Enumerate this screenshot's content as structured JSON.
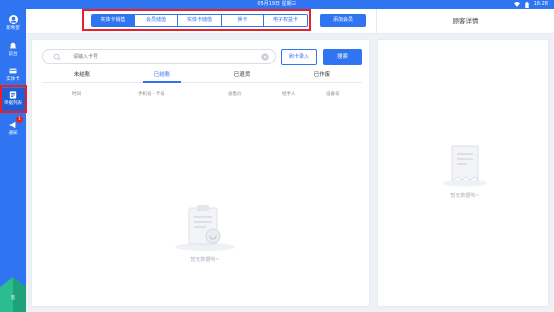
{
  "status_bar": {
    "date": "05月19日 星期三",
    "time": "18:28"
  },
  "sidebar": {
    "store": "新希望",
    "items": [
      {
        "label": "前台"
      },
      {
        "label": "实体卡"
      },
      {
        "label": "单据列表",
        "active": true
      },
      {
        "label": "通知",
        "badge": "1"
      }
    ],
    "corner_label": "签"
  },
  "top_tabs": [
    {
      "label": "实体卡销售",
      "active": true
    },
    {
      "label": "会员储值",
      "active": false
    },
    {
      "label": "实体卡储值",
      "active": false
    },
    {
      "label": "换卡",
      "active": false
    },
    {
      "label": "电子权益卡",
      "active": false
    }
  ],
  "add_member_label": "添加会员",
  "detail_title": "顾客详情",
  "search": {
    "placeholder": "请输入卡号",
    "value": ""
  },
  "card_entry_label": "刷卡录入",
  "search_button_label": "搜索",
  "status_tabs": [
    {
      "label": "未结账",
      "active": false
    },
    {
      "label": "已结账",
      "active": true
    },
    {
      "label": "已退货",
      "active": false
    },
    {
      "label": "已作废",
      "active": false
    }
  ],
  "columns": [
    "时间",
    "手机号 · 卡号",
    "总售价",
    "经手人",
    "设备号"
  ],
  "empty_text": "暂无数据哟~",
  "detail_empty_text": "暂无数据哟~",
  "colors": {
    "primary": "#2f74f0",
    "highlight": "#e8202a"
  }
}
